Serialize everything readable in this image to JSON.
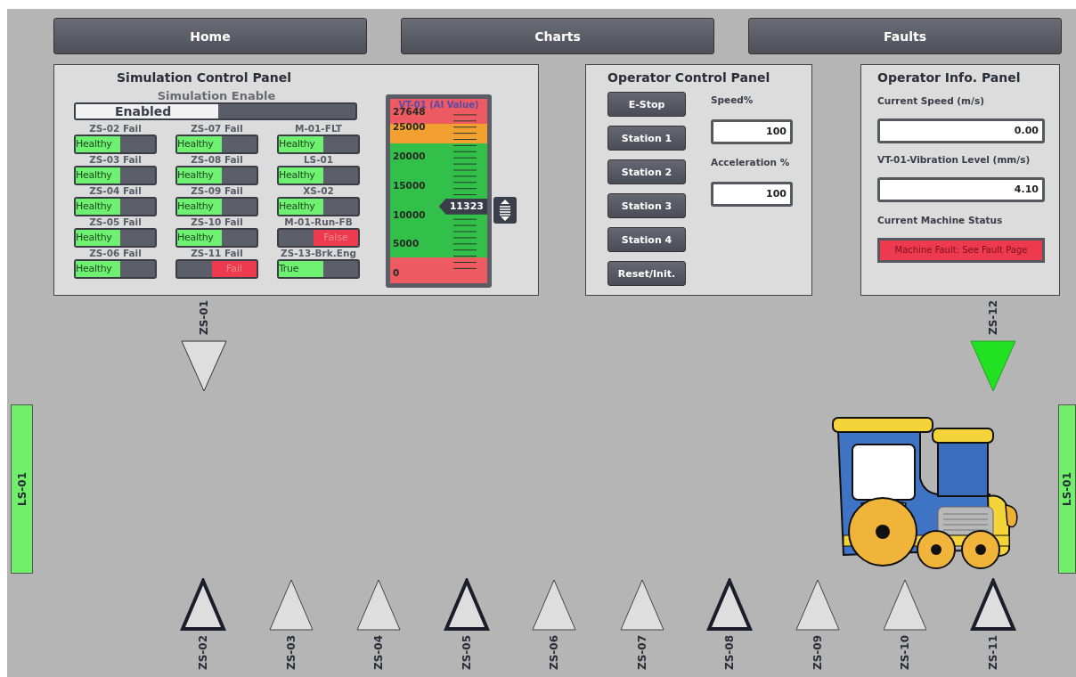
{
  "nav": [
    {
      "label": "Home"
    },
    {
      "label": "Charts"
    },
    {
      "label": "Faults"
    }
  ],
  "simulation_panel": {
    "title": "Simulation Control Panel",
    "enable": {
      "label": "Simulation Enable",
      "value": "Enabled",
      "on": true
    },
    "toggles": [
      {
        "label": "ZS-02 Fail",
        "value": "Healthy",
        "on": true
      },
      {
        "label": "ZS-07 Fail",
        "value": "Healthy",
        "on": true
      },
      {
        "label": "M-01-FLT",
        "value": "Healthy",
        "on": true
      },
      {
        "label": "ZS-03 Fail",
        "value": "Healthy",
        "on": true
      },
      {
        "label": "ZS-08 Fail",
        "value": "Healthy",
        "on": true
      },
      {
        "label": "LS-01",
        "value": "Healthy",
        "on": true
      },
      {
        "label": "ZS-04 Fail",
        "value": "Healthy",
        "on": true
      },
      {
        "label": "ZS-09 Fail",
        "value": "Healthy",
        "on": true
      },
      {
        "label": "XS-02",
        "value": "Healthy",
        "on": true
      },
      {
        "label": "ZS-05 Fail",
        "value": "Healthy",
        "on": true
      },
      {
        "label": "ZS-10 Fail",
        "value": "Healthy",
        "on": true
      },
      {
        "label": "M-01-Run-FB",
        "value": "False",
        "on": false
      },
      {
        "label": "ZS-06 Fail",
        "value": "Healthy",
        "on": true
      },
      {
        "label": "ZS-11 Fail",
        "value": "Fail",
        "on": false
      },
      {
        "label": "ZS-13-Brk.Eng",
        "value": "True",
        "on": true
      }
    ],
    "gauge": {
      "title": "VT-01 (AI Value)",
      "ticks": [
        "27648",
        "25000",
        "20000",
        "15000",
        "10000",
        "5000",
        "0"
      ],
      "pointer": {
        "value": "11323",
        "level": 0.41
      }
    }
  },
  "operator_control_panel": {
    "title": "Operator Control Panel",
    "buttons": [
      {
        "label": "E-Stop"
      },
      {
        "label": "Station 1"
      },
      {
        "label": "Station 2"
      },
      {
        "label": "Station 3"
      },
      {
        "label": "Station 4"
      },
      {
        "label": "Reset/Init."
      }
    ],
    "fields": [
      {
        "label": "Speed%",
        "value": "100"
      },
      {
        "label": "Acceleration %",
        "value": "100"
      }
    ]
  },
  "operator_info_panel": {
    "title": "Operator Info. Panel",
    "fields": [
      {
        "label": "Current Speed (m/s)",
        "value": "0.00"
      },
      {
        "label": "VT-01-Vibration Level (mm/s)",
        "value": "4.10"
      }
    ],
    "status": {
      "label": "Current Machine Status",
      "value": "Machine Fault: See Fault Page",
      "kind": "fault"
    }
  },
  "track": {
    "top_sensors": [
      {
        "label": "ZS-01",
        "active": false
      },
      {
        "label": "ZS-12",
        "active": true
      }
    ],
    "limit_switches": [
      {
        "label": "LS-01",
        "on": true
      },
      {
        "label": "LS-01",
        "on": true
      }
    ],
    "bottom_sensors": [
      {
        "label": "ZS-02",
        "station": true,
        "active": false
      },
      {
        "label": "ZS-03",
        "station": false,
        "active": false
      },
      {
        "label": "ZS-04",
        "station": false,
        "active": false
      },
      {
        "label": "ZS-05",
        "station": true,
        "active": false
      },
      {
        "label": "ZS-06",
        "station": false,
        "active": false
      },
      {
        "label": "ZS-07",
        "station": false,
        "active": false
      },
      {
        "label": "ZS-08",
        "station": true,
        "active": false
      },
      {
        "label": "ZS-09",
        "station": false,
        "active": false
      },
      {
        "label": "ZS-10",
        "station": false,
        "active": false
      },
      {
        "label": "ZS-11",
        "station": true,
        "active": false
      }
    ]
  }
}
